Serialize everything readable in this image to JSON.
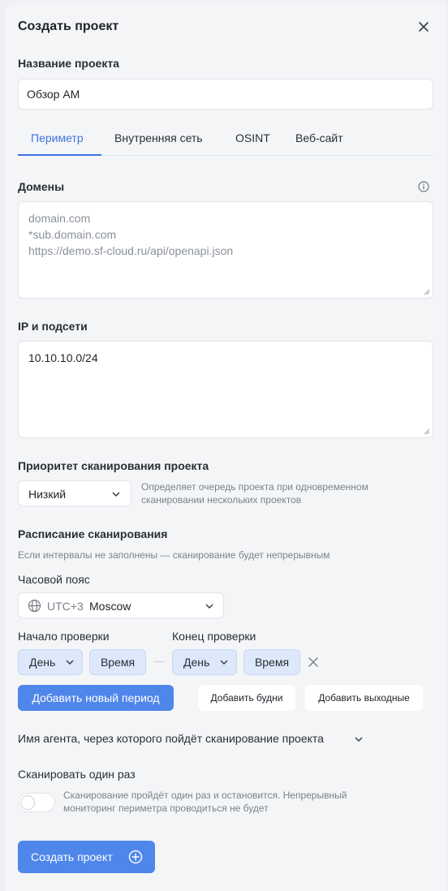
{
  "dialog": {
    "title": "Создать проект"
  },
  "project_name": {
    "label": "Название проекта",
    "value": "Обзор АМ"
  },
  "tabs": [
    {
      "label": "Периметр",
      "active": true
    },
    {
      "label": "Внутренняя сеть",
      "active": false
    },
    {
      "label": "OSINT",
      "active": false
    },
    {
      "label": "Веб-сайт",
      "active": false
    }
  ],
  "domains": {
    "label": "Домены",
    "placeholder": "domain.com\n*sub.domain.com\nhttps://demo.sf-cloud.ru/api/openapi.json"
  },
  "ip": {
    "label": "IP и подсети",
    "value": "10.10.10.0/24"
  },
  "priority": {
    "label": "Приоритет сканирования проекта",
    "value": "Низкий",
    "hint": "Определяет очередь проекта при одновременном сканировании нескольких проектов"
  },
  "schedule": {
    "label": "Расписание сканирования",
    "hint": "Если интервалы не заполнены — сканирование будет непрерывным",
    "timezone_label": "Часовой пояс",
    "timezone_offset": "UTC+3",
    "timezone_city": "Moscow",
    "start_label": "Начало проверки",
    "end_label": "Конец проверки",
    "start_day": "День",
    "start_time": "Время",
    "end_day": "День",
    "end_time": "Время",
    "separator": "—",
    "add_period": "Добавить новый период",
    "add_weekdays": "Добавить будни",
    "add_weekends": "Добавить выходные"
  },
  "agent": {
    "label": "Имя агента, через которого пойдёт сканирование проекта"
  },
  "scan_once": {
    "label": "Сканировать один раз",
    "hint": "Сканирование пройдёт один раз и остановится. Непрерывный мониторинг периметра проводиться не будет",
    "enabled": false
  },
  "submit": {
    "label": "Создать проект"
  },
  "colors": {
    "accent": "#3b73e0",
    "primary_button": "#4f86ea",
    "pill_bg": "#dde8fb"
  }
}
